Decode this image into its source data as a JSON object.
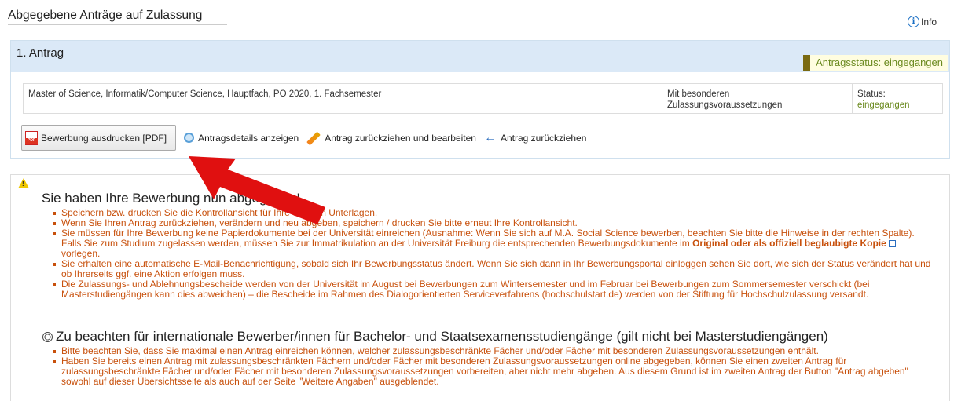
{
  "page": {
    "title": "Abgegebene Anträge auf Zulassung",
    "info_label": "Info"
  },
  "application": {
    "title": "1. Antrag",
    "status_badge": "Antragsstatus: eingegangen",
    "program": "Master of Science, Informatik/Computer Science, Hauptfach, PO 2020, 1. Fachsemester",
    "requirements_line1": "Mit besonderen",
    "requirements_line2": "Zulassungsvoraussetzungen",
    "status_label": "Status:",
    "status_value": "eingegangen",
    "status_color": "#6b8a1f"
  },
  "actions": {
    "print_label": "Bewerbung ausdrucken [PDF]",
    "details_label": "Antragsdetails anzeigen",
    "withdraw_edit_label": "Antrag zurückziehen und bearbeiten",
    "withdraw_label": "Antrag zurückziehen"
  },
  "notice": {
    "heading": "Sie haben Ihre Bewerbung nun abgegeben!",
    "items": [
      "Speichern bzw. drucken Sie die Kontrollansicht für Ihre eigenen Unterlagen.",
      "Wenn Sie Ihren Antrag zurückziehen, verändern und neu abgeben, speichern / drucken Sie bitte erneut Ihre Kontrollansicht.",
      "Sie müssen für Ihre Bewerbung keine Papierdokumente bei der Universität einreichen (Ausnahme: Wenn Sie sich auf M.A. Social Science bewerben, beachten Sie bitte die Hinweise in der rechten Spalte). Falls Sie zum Studium zugelassen werden, müssen Sie zur Immatrikulation an der Universität Freiburg die entsprechenden Bewerbungsdokumente im",
      "Sie erhalten eine automatische E-Mail-Benachrichtigung, sobald sich Ihr Bewerbungsstatus ändert. Wenn Sie sich dann in Ihr Bewerbungsportal einloggen sehen Sie dort, wie sich der Status verändert hat und ob Ihrerseits ggf. eine Aktion erfolgen muss.",
      "Die Zulassungs- und Ablehnungsbescheide werden von der Universität im August bei Bewerbungen zum Wintersemester und im Februar bei Bewerbungen zum Sommersemester verschickt (bei Masterstudiengängen kann dies abweichen) – die Bescheide im Rahmen des Dialogorientierten Serviceverfahrens (hochschulstart.de) werden von der Stiftung für Hochschulzulassung versandt."
    ],
    "bold_link": "Original oder als offiziell beglaubigte Kopie",
    "item3_suffix": "vorlegen.",
    "intl_heading": "Zu beachten für internationale Bewerber/innen für Bachelor- und Staatsexamensstudiengänge (gilt nicht bei Masterstudiengängen)",
    "intl_items": [
      "Bitte beachten Sie, dass Sie maximal einen Antrag einreichen können, welcher zulassungsbeschränkte Fächer und/oder Fächer mit besonderen Zulassungsvoraussetzungen enthält.",
      "Haben Sie bereits einen Antrag mit zulassungsbeschränkten Fächern und/oder Fächer mit besonderen Zulassungsvoraussetzungen online abgegeben, können Sie einen zweiten Antrag für zulassungsbeschränkte Fächer und/oder Fächer mit besonderen Zulassungsvoraussetzungen vorbereiten, aber nicht mehr abgeben. Aus diesem Grund ist im zweiten Antrag der Button \"Antrag abgeben\" sowohl auf dieser Übersichtsseite als auch auf der Seite \"Weitere Angaben\" ausgeblendet."
    ]
  },
  "colors": {
    "header_bg": "#dbe9f7",
    "notice_text": "#c8510d",
    "annotation_arrow": "#e01010"
  }
}
